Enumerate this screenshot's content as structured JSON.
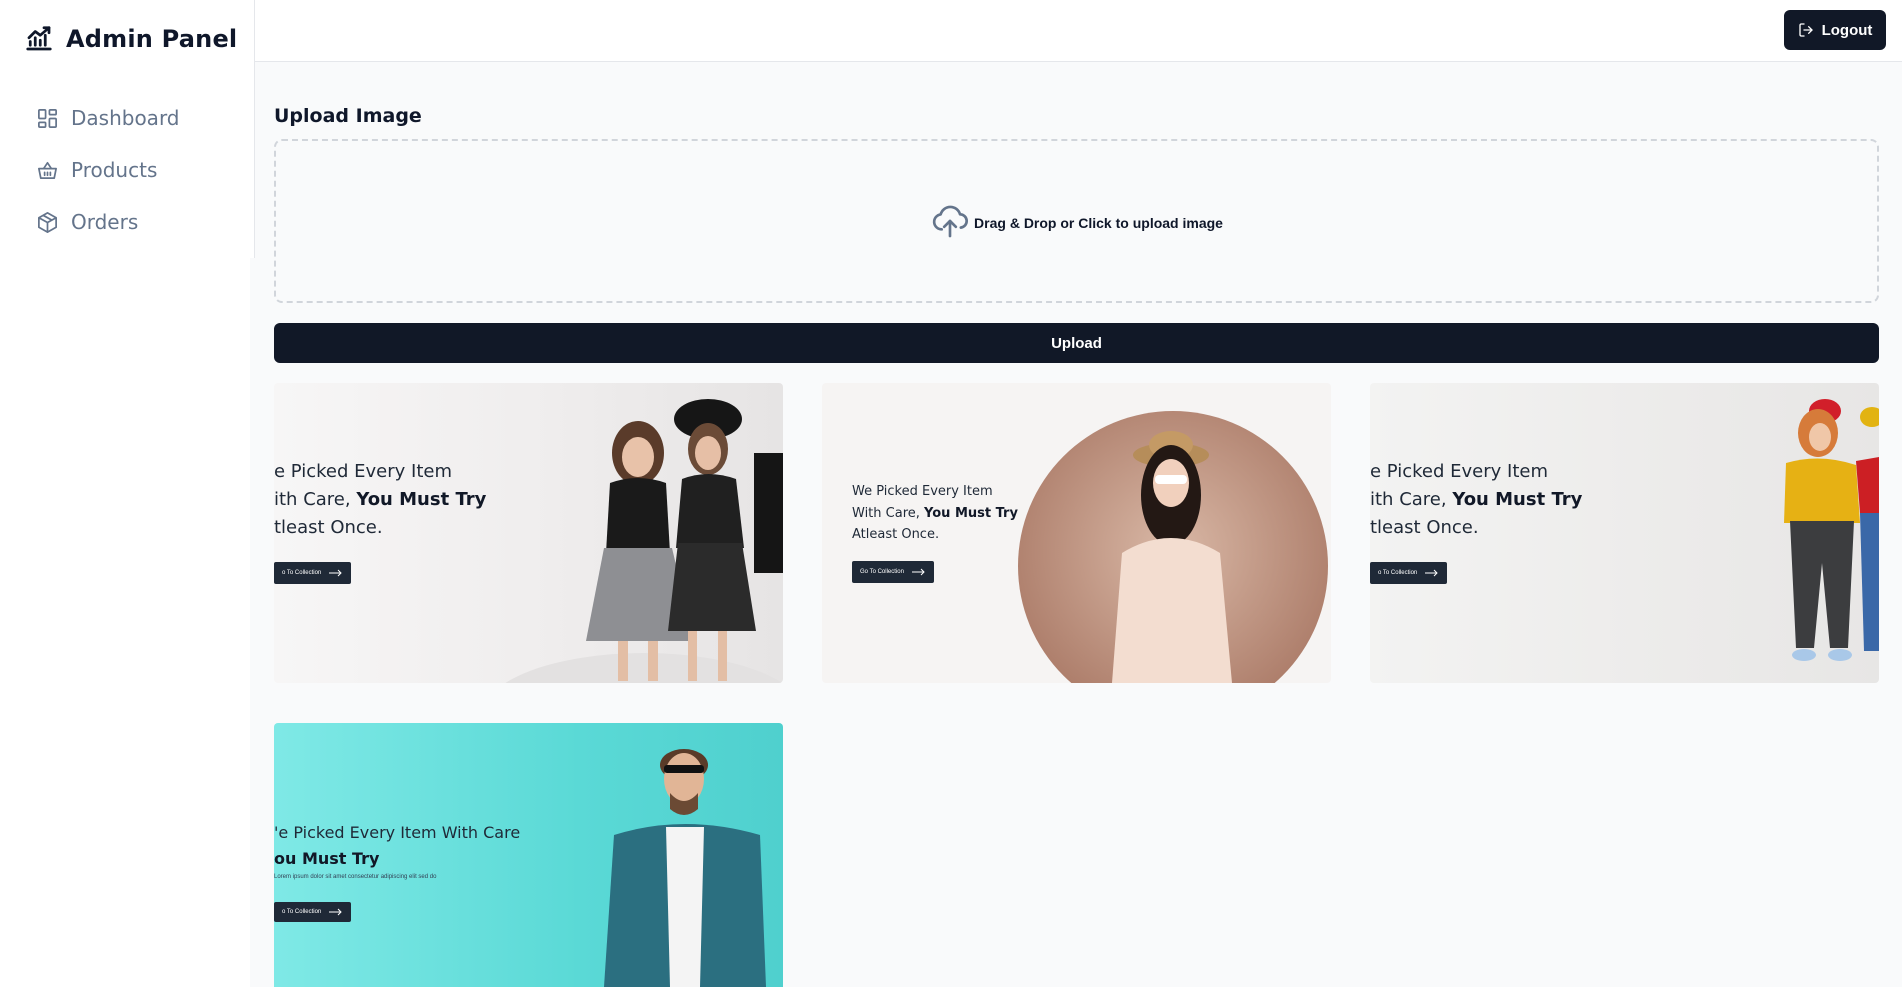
{
  "brand": {
    "title": "Admin Panel",
    "icon": "chart-line-icon"
  },
  "nav": [
    {
      "label": "Dashboard",
      "icon": "dashboard-icon"
    },
    {
      "label": "Products",
      "icon": "basket-icon"
    },
    {
      "label": "Orders",
      "icon": "package-icon"
    }
  ],
  "topbar": {
    "logout_label": "Logout",
    "logout_icon": "logout-icon"
  },
  "upload": {
    "title": "Upload Image",
    "dropzone_text": "Drag & Drop or Click to upload image",
    "dropzone_icon": "cloud-upload-icon",
    "button_label": "Upload"
  },
  "banners": [
    {
      "line1": "e Picked Every Item",
      "line2_prefix": "ith Care, ",
      "line2_strong": "You Must Try",
      "line3": "tleast Once.",
      "cta": "o To Collection"
    },
    {
      "line1": "We Picked Every Item",
      "line2_prefix": "With Care, ",
      "line2_strong": "You Must Try",
      "line3": "Atleast Once.",
      "cta": "Go To Collection"
    },
    {
      "line1": "e Picked Every Item",
      "line2_prefix": "ith Care, ",
      "line2_strong": "You Must Try",
      "line3": "tleast Once.",
      "cta": "o To Collection"
    },
    {
      "line1": "'e Picked Every Item With Care",
      "line2_strong": "ou Must Try",
      "fine_print": "Lorem ipsum dolor sit amet consectetur adipiscing elit sed do",
      "cta": "o To Collection"
    }
  ],
  "colors": {
    "primary": "#111827",
    "muted_text": "#64748b",
    "background": "#f9fafb"
  }
}
